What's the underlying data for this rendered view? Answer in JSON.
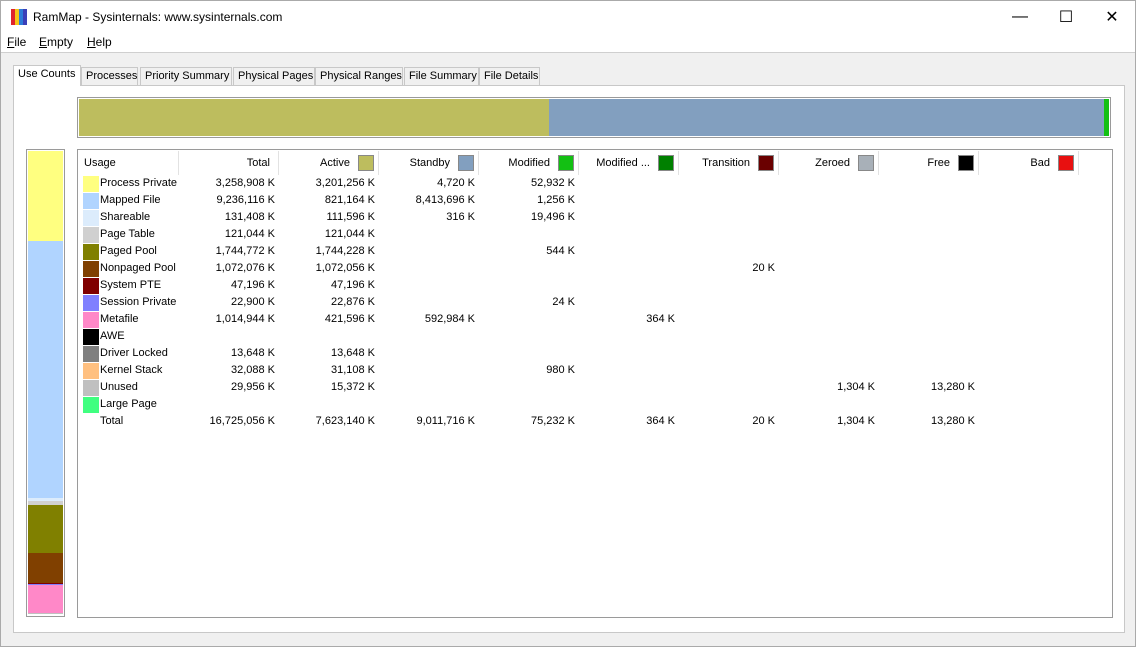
{
  "window": {
    "title": "RamMap - Sysinternals: www.sysinternals.com",
    "icon_colors": [
      "#e0242c",
      "#f5c518",
      "#2d7bd8",
      "#3b3fb8"
    ],
    "minimize_glyph": "—",
    "maximize_glyph": "☐",
    "close_glyph": "✕"
  },
  "menu": [
    {
      "label": "File"
    },
    {
      "label": "Empty"
    },
    {
      "label": "Help"
    }
  ],
  "tabs": [
    {
      "label": "Use Counts",
      "active": true
    },
    {
      "label": "Processes"
    },
    {
      "label": "Priority Summary"
    },
    {
      "label": "Physical Pages"
    },
    {
      "label": "Physical Ranges"
    },
    {
      "label": "File Summary"
    },
    {
      "label": "File Details"
    }
  ],
  "top_bar_segments": [
    {
      "name": "active",
      "color": "#bdbd5e",
      "share": 0.4565
    },
    {
      "name": "standby",
      "color": "#829fbf",
      "share": 0.5387
    },
    {
      "name": "modified",
      "color": "#13c013",
      "share": 0.0048
    }
  ],
  "side_bar_segments": [
    {
      "name": "process-private",
      "color": "#ffff80",
      "share": 0.1948
    },
    {
      "name": "mapped-file",
      "color": "#b0d4ff",
      "share": 0.5522
    },
    {
      "name": "shareable",
      "color": "#dcecfc",
      "share": 0.0079
    },
    {
      "name": "page-table",
      "color": "#d0d0d0",
      "share": 0.0072
    },
    {
      "name": "paged-pool",
      "color": "#808000",
      "share": 0.1043
    },
    {
      "name": "nonpaged-pool",
      "color": "#804000",
      "share": 0.0641
    },
    {
      "name": "system-pte",
      "color": "#800000",
      "share": 0.0028
    },
    {
      "name": "session-private",
      "color": "#8080ff",
      "share": 0.0014
    },
    {
      "name": "metafile",
      "color": "#ff88c8",
      "share": 0.0607
    },
    {
      "name": "unused",
      "color": "#c0c0c0",
      "share": 0.0018
    }
  ],
  "columns": [
    {
      "key": "usage",
      "label": "Usage"
    },
    {
      "key": "total",
      "label": "Total"
    },
    {
      "key": "active",
      "label": "Active",
      "color": "#bdbd5e"
    },
    {
      "key": "standby",
      "label": "Standby",
      "color": "#829fbf"
    },
    {
      "key": "modified",
      "label": "Modified",
      "color": "#13c013"
    },
    {
      "key": "modnowrite",
      "label": "Modified ...",
      "color": "#008000"
    },
    {
      "key": "transition",
      "label": "Transition",
      "color": "#6a0000"
    },
    {
      "key": "zeroed",
      "label": "Zeroed",
      "color": "#a8b0b8"
    },
    {
      "key": "free",
      "label": "Free",
      "color": "#000000"
    },
    {
      "key": "bad",
      "label": "Bad",
      "color": "#e81010"
    }
  ],
  "rows": [
    {
      "usage": "Process Private",
      "color": "#ffff80",
      "total": "3,258,908 K",
      "active": "3,201,256 K",
      "standby": "4,720 K",
      "modified": "52,932 K",
      "modnowrite": "",
      "transition": "",
      "zeroed": "",
      "free": "",
      "bad": ""
    },
    {
      "usage": "Mapped File",
      "color": "#b0d4ff",
      "total": "9,236,116 K",
      "active": "821,164 K",
      "standby": "8,413,696 K",
      "modified": "1,256 K",
      "modnowrite": "",
      "transition": "",
      "zeroed": "",
      "free": "",
      "bad": ""
    },
    {
      "usage": "Shareable",
      "color": "#dcecfc",
      "total": "131,408 K",
      "active": "111,596 K",
      "standby": "316 K",
      "modified": "19,496 K",
      "modnowrite": "",
      "transition": "",
      "zeroed": "",
      "free": "",
      "bad": ""
    },
    {
      "usage": "Page Table",
      "color": "#d0d0d0",
      "total": "121,044 K",
      "active": "121,044 K",
      "standby": "",
      "modified": "",
      "modnowrite": "",
      "transition": "",
      "zeroed": "",
      "free": "",
      "bad": ""
    },
    {
      "usage": "Paged Pool",
      "color": "#808000",
      "total": "1,744,772 K",
      "active": "1,744,228 K",
      "standby": "",
      "modified": "544 K",
      "modnowrite": "",
      "transition": "",
      "zeroed": "",
      "free": "",
      "bad": ""
    },
    {
      "usage": "Nonpaged Pool",
      "color": "#804000",
      "total": "1,072,076 K",
      "active": "1,072,056 K",
      "standby": "",
      "modified": "",
      "modnowrite": "",
      "transition": "20 K",
      "zeroed": "",
      "free": "",
      "bad": ""
    },
    {
      "usage": "System PTE",
      "color": "#800000",
      "total": "47,196 K",
      "active": "47,196 K",
      "standby": "",
      "modified": "",
      "modnowrite": "",
      "transition": "",
      "zeroed": "",
      "free": "",
      "bad": ""
    },
    {
      "usage": "Session Private",
      "color": "#8080ff",
      "total": "22,900 K",
      "active": "22,876 K",
      "standby": "",
      "modified": "24 K",
      "modnowrite": "",
      "transition": "",
      "zeroed": "",
      "free": "",
      "bad": ""
    },
    {
      "usage": "Metafile",
      "color": "#ff88c8",
      "total": "1,014,944 K",
      "active": "421,596 K",
      "standby": "592,984 K",
      "modified": "",
      "modnowrite": "364 K",
      "transition": "",
      "zeroed": "",
      "free": "",
      "bad": ""
    },
    {
      "usage": "AWE",
      "color": "#000000",
      "total": "",
      "active": "",
      "standby": "",
      "modified": "",
      "modnowrite": "",
      "transition": "",
      "zeroed": "",
      "free": "",
      "bad": ""
    },
    {
      "usage": "Driver Locked",
      "color": "#808080",
      "total": "13,648 K",
      "active": "13,648 K",
      "standby": "",
      "modified": "",
      "modnowrite": "",
      "transition": "",
      "zeroed": "",
      "free": "",
      "bad": ""
    },
    {
      "usage": "Kernel Stack",
      "color": "#ffc080",
      "total": "32,088 K",
      "active": "31,108 K",
      "standby": "",
      "modified": "980 K",
      "modnowrite": "",
      "transition": "",
      "zeroed": "",
      "free": "",
      "bad": ""
    },
    {
      "usage": "Unused",
      "color": "#c0c0c0",
      "total": "29,956 K",
      "active": "15,372 K",
      "standby": "",
      "modified": "",
      "modnowrite": "",
      "transition": "",
      "zeroed": "1,304 K",
      "free": "13,280 K",
      "bad": ""
    },
    {
      "usage": "Large Page",
      "color": "#40ff80",
      "total": "",
      "active": "",
      "standby": "",
      "modified": "",
      "modnowrite": "",
      "transition": "",
      "zeroed": "",
      "free": "",
      "bad": ""
    },
    {
      "usage": "Total",
      "color": "",
      "total": "16,725,056 K",
      "active": "7,623,140 K",
      "standby": "9,011,716 K",
      "modified": "75,232 K",
      "modnowrite": "364 K",
      "transition": "20 K",
      "zeroed": "1,304 K",
      "free": "13,280 K",
      "bad": ""
    }
  ]
}
